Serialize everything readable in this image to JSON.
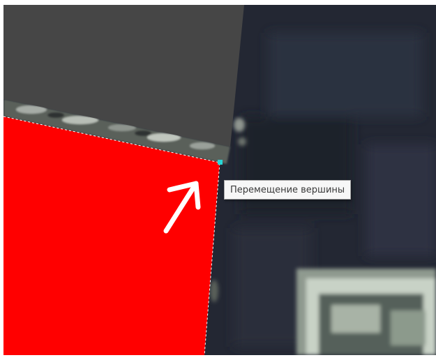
{
  "tooltip": {
    "text": "Перемещение вершины"
  },
  "colors": {
    "polygon_fill": "#ff0000",
    "upper_shape_fill": "#464646",
    "vertex_handle": "#28d7d7",
    "outline_dash": "#ffffff",
    "annotation_arrow": "#ffffff"
  },
  "icons": {
    "vertex_handle": "vertex-handle-icon",
    "annotation_arrow": "arrow-icon"
  }
}
